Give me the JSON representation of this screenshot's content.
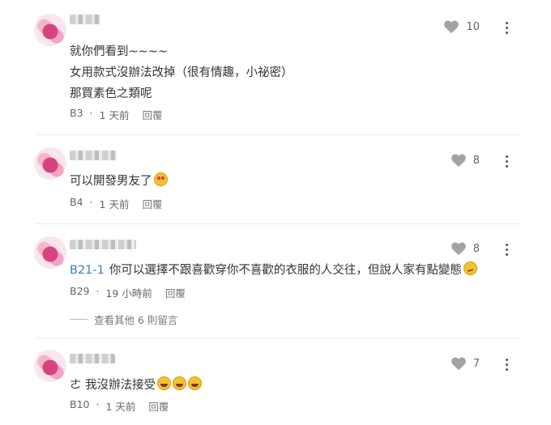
{
  "comments": [
    {
      "likes": "10",
      "lines": [
        "就你們看到~~~~",
        "女用款式沒辦法改掉（很有情趣，小祕密）",
        "那買素色之類呢"
      ],
      "floor": "B3",
      "time": "1 天前",
      "reply_label": "回覆"
    },
    {
      "likes": "8",
      "lines": [
        "可以開發男友了"
      ],
      "emoji": "heart-eyes-emoji",
      "floor": "B4",
      "time": "1 天前",
      "reply_label": "回覆"
    },
    {
      "likes": "8",
      "mention": "B21-1",
      "lines": [
        "你可以選擇不跟喜歡穿你不喜歡的衣服的人交往，但說人家有點變態"
      ],
      "emoji": "thinking-emoji",
      "floor": "B29",
      "time": "19 小時前",
      "reply_label": "回覆",
      "more_replies": "查看其他 6 則留言"
    },
    {
      "likes": "7",
      "lines": [
        "ㄜ 我沒辦法接受"
      ],
      "emoji": "laughing-emoji",
      "floor": "B10",
      "time": "1 天前",
      "reply_label": "回覆"
    }
  ],
  "separator": "·"
}
